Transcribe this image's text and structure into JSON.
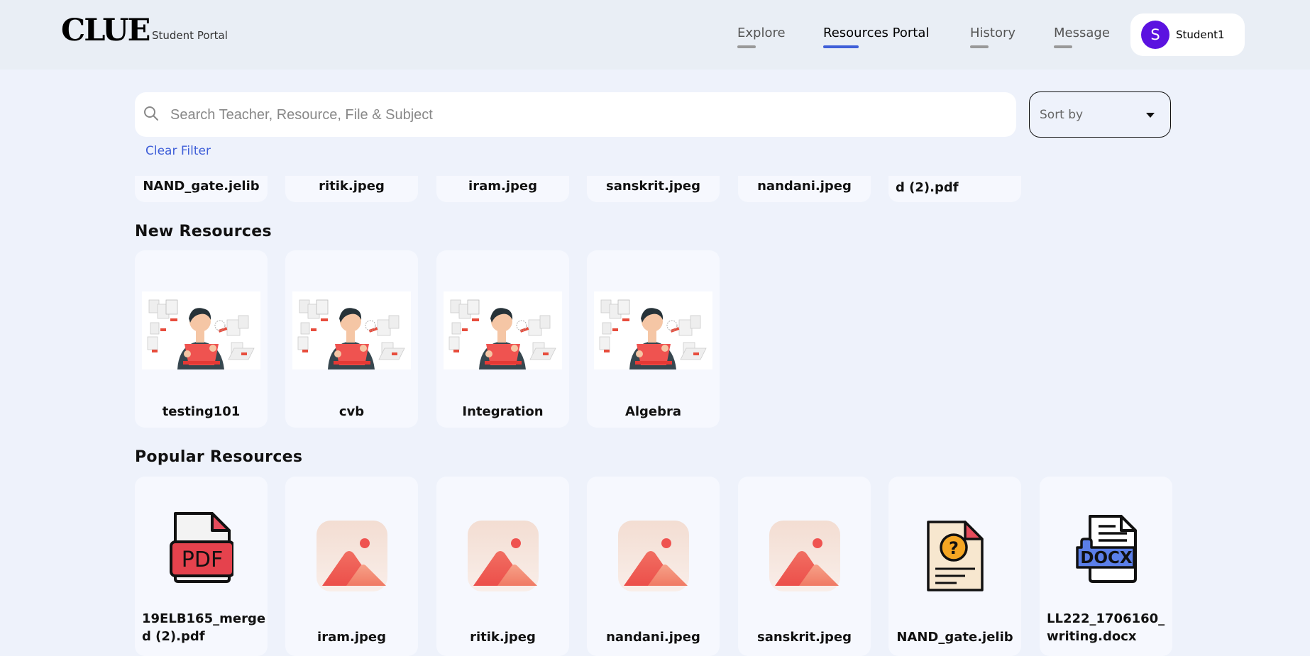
{
  "header": {
    "logo": "CLUE",
    "subtitle": "Student Portal",
    "nav": [
      {
        "label": "Explore",
        "active": false
      },
      {
        "label": "Resources Portal",
        "active": true
      },
      {
        "label": "History",
        "active": false
      },
      {
        "label": "Message",
        "active": false
      }
    ],
    "profile": {
      "initial": "S",
      "name": "Student1"
    }
  },
  "search": {
    "placeholder": "Search Teacher, Resource, File & Subject",
    "value": ""
  },
  "sort": {
    "label": "Sort by"
  },
  "clear_filter": "Clear Filter",
  "top_row": [
    "NAND_gate.jelib",
    "ritik.jpeg",
    "iram.jpeg",
    "sanskrit.jpeg",
    "nandani.jpeg",
    "d (2).pdf"
  ],
  "new_resources": {
    "title": "New Resources",
    "items": [
      "testing101",
      "cvb",
      "Integration",
      "Algebra"
    ]
  },
  "popular_resources": {
    "title": "Popular Resources",
    "items": [
      {
        "label": "19ELB165_merged (2).pdf",
        "icon": "pdf-file-icon"
      },
      {
        "label": "iram.jpeg",
        "icon": "image-file-icon"
      },
      {
        "label": "ritik.jpeg",
        "icon": "image-file-icon"
      },
      {
        "label": "nandani.jpeg",
        "icon": "image-file-icon"
      },
      {
        "label": "sanskrit.jpeg",
        "icon": "image-file-icon"
      },
      {
        "label": "NAND_gate.jelib",
        "icon": "unknown-file-icon"
      },
      {
        "label": "LL222_1706160_writing.docx",
        "icon": "docx-file-icon"
      }
    ]
  },
  "colors": {
    "accent": "#3f5fd8",
    "avatar": "#5b12e0",
    "page_bg": "#eef2fb",
    "header_bg": "#e9eef5"
  }
}
